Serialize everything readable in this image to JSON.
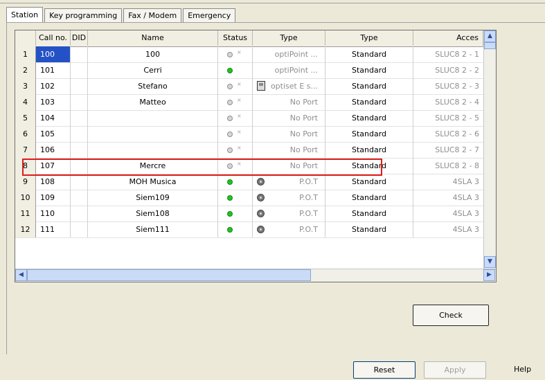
{
  "tabs": [
    "Station",
    "Key programming",
    "Fax / Modem",
    "Emergency"
  ],
  "table": {
    "columns": [
      "Call no.",
      "DID",
      "Name",
      "Status",
      "Type",
      "Type",
      "Acces"
    ],
    "rows": [
      {
        "n": "1",
        "call": "100",
        "name": "100",
        "status": "off",
        "type1": "optiPoint ...",
        "type1_icon": "",
        "type2": "Standard",
        "access": "SLUC8  2 - 1"
      },
      {
        "n": "2",
        "call": "101",
        "name": "Cerri",
        "status": "green",
        "type1": "optiPoint ...",
        "type1_icon": "",
        "type2": "Standard",
        "access": "SLUC8  2 - 2"
      },
      {
        "n": "3",
        "call": "102",
        "name": "Stefano",
        "status": "off",
        "type1": "optiset E s...",
        "type1_icon": "phone-device-icon",
        "type2": "Standard",
        "access": "SLUC8  2 - 3"
      },
      {
        "n": "4",
        "call": "103",
        "name": "Matteo",
        "status": "off",
        "type1": "No Port",
        "type1_icon": "",
        "type2": "Standard",
        "access": "SLUC8  2 - 4"
      },
      {
        "n": "5",
        "call": "104",
        "name": "",
        "status": "off",
        "type1": "No Port",
        "type1_icon": "",
        "type2": "Standard",
        "access": "SLUC8  2 - 5"
      },
      {
        "n": "6",
        "call": "105",
        "name": "",
        "status": "off",
        "type1": "No Port",
        "type1_icon": "",
        "type2": "Standard",
        "access": "SLUC8  2 - 6"
      },
      {
        "n": "7",
        "call": "106",
        "name": "",
        "status": "off",
        "type1": "No Port",
        "type1_icon": "",
        "type2": "Standard",
        "access": "SLUC8  2 - 7"
      },
      {
        "n": "8",
        "call": "107",
        "name": "Mercre",
        "status": "off",
        "type1": "No Port",
        "type1_icon": "",
        "type2": "Standard",
        "access": "SLUC8  2 - 8"
      },
      {
        "n": "9",
        "call": "108",
        "name": "MOH Musica",
        "status": "green",
        "type1": "P.O.T",
        "type1_icon": "rotary-dial-icon",
        "type2": "Standard",
        "access": "4SLA  3"
      },
      {
        "n": "10",
        "call": "109",
        "name": "Siem109",
        "status": "green",
        "type1": "P.O.T",
        "type1_icon": "rotary-dial-icon",
        "type2": "Standard",
        "access": "4SLA  3"
      },
      {
        "n": "11",
        "call": "110",
        "name": "Siem108",
        "status": "green",
        "type1": "P.O.T",
        "type1_icon": "rotary-dial-icon",
        "type2": "Standard",
        "access": "4SLA  3"
      },
      {
        "n": "12",
        "call": "111",
        "name": "Siem111",
        "status": "green",
        "type1": "P.O.T",
        "type1_icon": "rotary-dial-icon",
        "type2": "Standard",
        "access": "4SLA  3"
      }
    ],
    "selected_cell_row": 1,
    "highlighted_row": 9
  },
  "buttons": {
    "check": "Check",
    "reset": "Reset",
    "apply": "Apply",
    "help": "Help"
  }
}
